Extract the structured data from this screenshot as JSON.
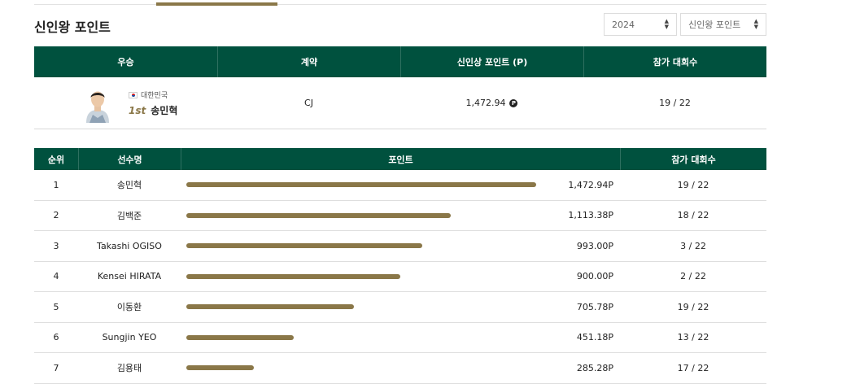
{
  "page": {
    "title": "신인왕 포인트"
  },
  "filters": {
    "year": {
      "value": "2024"
    },
    "category": {
      "value": "신인왕 포인트"
    }
  },
  "winner_table": {
    "headers": {
      "winner": "우승",
      "contract": "계약",
      "points": "신인상 포인트 (P)",
      "events": "참가 대회수"
    },
    "row": {
      "nationality": "대한민국",
      "rank": "1st",
      "name": "송민혁",
      "contract": "CJ",
      "points": "1,472.94",
      "points_icon": "P",
      "events": "19 / 22"
    }
  },
  "ranking_table": {
    "headers": {
      "rank": "순위",
      "name": "선수명",
      "points": "포인트",
      "events": "참가 대회수"
    },
    "max_points": 1472.94,
    "rows": [
      {
        "rank": "1",
        "name": "송민혁",
        "points": "1,472.94P",
        "value": 1472.94,
        "events": "19 / 22"
      },
      {
        "rank": "2",
        "name": "김백준",
        "points": "1,113.38P",
        "value": 1113.38,
        "events": "18 / 22"
      },
      {
        "rank": "3",
        "name": "Takashi OGISO",
        "points": "993.00P",
        "value": 993.0,
        "events": "3 / 22"
      },
      {
        "rank": "4",
        "name": "Kensei HIRATA",
        "points": "900.00P",
        "value": 900.0,
        "events": "2 / 22"
      },
      {
        "rank": "5",
        "name": "이동환",
        "points": "705.78P",
        "value": 705.78,
        "events": "19 / 22"
      },
      {
        "rank": "6",
        "name": "Sungjin YEO",
        "points": "451.18P",
        "value": 451.18,
        "events": "13 / 22"
      },
      {
        "rank": "7",
        "name": "김용태",
        "points": "285.28P",
        "value": 285.28,
        "events": "17 / 22"
      }
    ]
  },
  "colors": {
    "header_bg": "#00513e",
    "bar": "#8a7748",
    "accent": "#8a7748"
  },
  "icons": {
    "select_arrow": "updown-chevron-icon",
    "points": "points-coin-icon",
    "flag": "korea-flag-icon"
  }
}
